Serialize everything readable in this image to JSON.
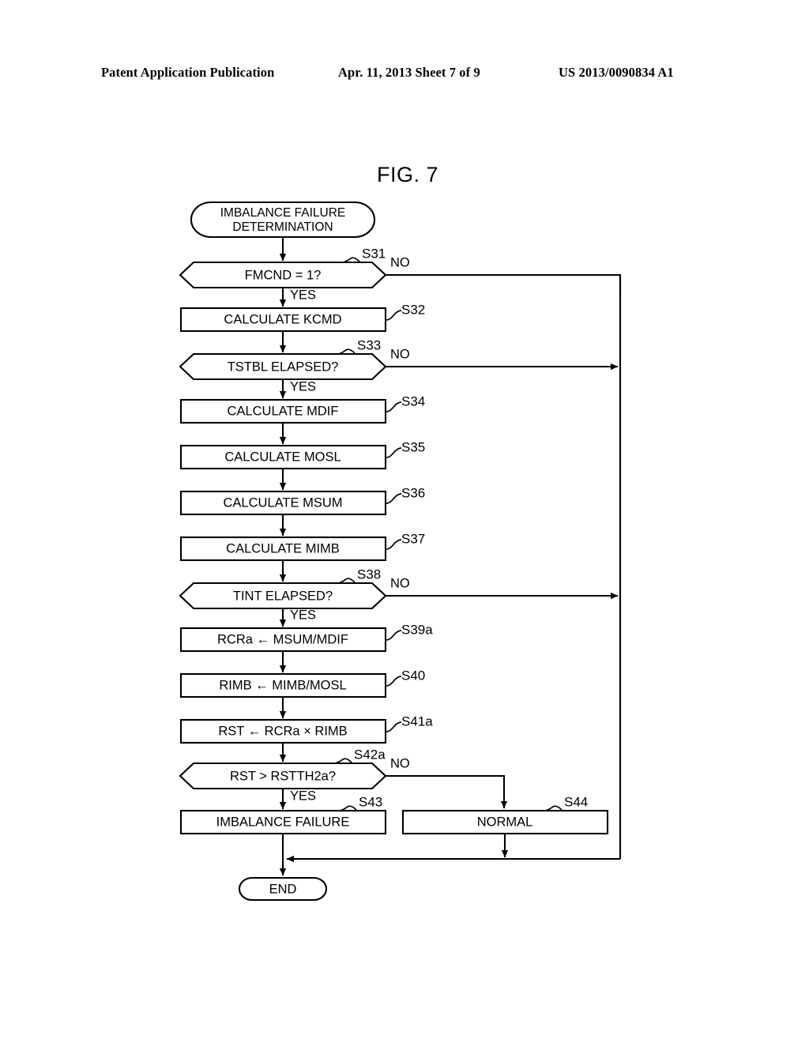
{
  "header": {
    "left": "Patent Application Publication",
    "middle": "Apr. 11, 2013  Sheet 7 of 9",
    "right": "US 2013/0090834 A1"
  },
  "figure": {
    "title": "FIG. 7"
  },
  "flowchart": {
    "start": {
      "id": "start",
      "type": "terminator",
      "line1": "IMBALANCE FAILURE",
      "line2": "DETERMINATION"
    },
    "end": {
      "id": "end",
      "type": "terminator",
      "label": "END"
    },
    "nodes": [
      {
        "id": "s31",
        "type": "decision",
        "label": "FMCND = 1?",
        "step": "S31",
        "yes": "YES",
        "no": "NO"
      },
      {
        "id": "s32",
        "type": "process",
        "label": "CALCULATE KCMD",
        "step": "S32"
      },
      {
        "id": "s33",
        "type": "decision",
        "label": "TSTBL ELAPSED?",
        "step": "S33",
        "yes": "YES",
        "no": "NO"
      },
      {
        "id": "s34",
        "type": "process",
        "label": "CALCULATE MDIF",
        "step": "S34"
      },
      {
        "id": "s35",
        "type": "process",
        "label": "CALCULATE MOSL",
        "step": "S35"
      },
      {
        "id": "s36",
        "type": "process",
        "label": "CALCULATE MSUM",
        "step": "S36"
      },
      {
        "id": "s37",
        "type": "process",
        "label": "CALCULATE MIMB",
        "step": "S37"
      },
      {
        "id": "s38",
        "type": "decision",
        "label": "TINT ELAPSED?",
        "step": "S38",
        "yes": "YES",
        "no": "NO"
      },
      {
        "id": "s39a",
        "type": "process",
        "label": "RCRa ← MSUM/MDIF",
        "step": "S39a"
      },
      {
        "id": "s40",
        "type": "process",
        "label": "RIMB ← MIMB/MOSL",
        "step": "S40"
      },
      {
        "id": "s41a",
        "type": "process",
        "label": "RST ← RCRa × RIMB",
        "step": "S41a"
      },
      {
        "id": "s42a",
        "type": "decision",
        "label": "RST > RSTTH2a?",
        "step": "S42a",
        "yes": "YES",
        "no": "NO"
      },
      {
        "id": "s43",
        "type": "process",
        "label": "IMBALANCE FAILURE",
        "step": "S43"
      },
      {
        "id": "s44",
        "type": "process",
        "label": "NORMAL",
        "step": "S44"
      }
    ]
  }
}
